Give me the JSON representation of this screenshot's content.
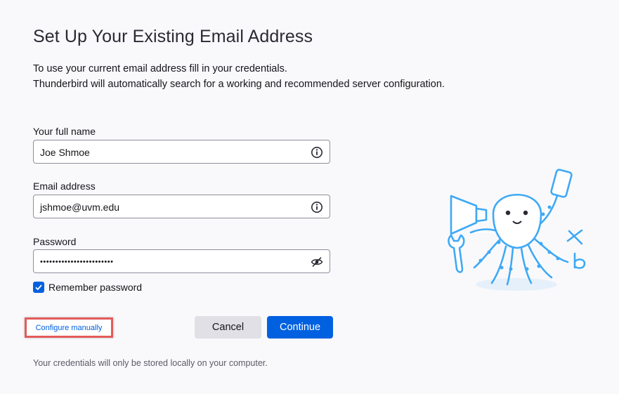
{
  "title": "Set Up Your Existing Email Address",
  "intro": {
    "line1": "To use your current email address fill in your credentials.",
    "line2": "Thunderbird will automatically search for a working and recommended server configuration."
  },
  "fields": {
    "name": {
      "label": "Your full name",
      "value": "Joe Shmoe",
      "icon": "info-icon"
    },
    "email": {
      "label": "Email address",
      "value": "jshmoe@uvm.edu",
      "icon": "info-icon"
    },
    "password": {
      "label": "Password",
      "value": "••••••••••••••••••••••••",
      "icon": "eye-slash-icon"
    }
  },
  "remember": {
    "label": "Remember password",
    "checked": true
  },
  "configure_link": "Configure manually",
  "buttons": {
    "cancel": "Cancel",
    "continue": "Continue"
  },
  "footnote": "Your credentials will only be stored locally on your computer.",
  "colors": {
    "accent": "#0061e0",
    "highlight": "#e35b5b",
    "mascot": "#3fa9f5"
  }
}
